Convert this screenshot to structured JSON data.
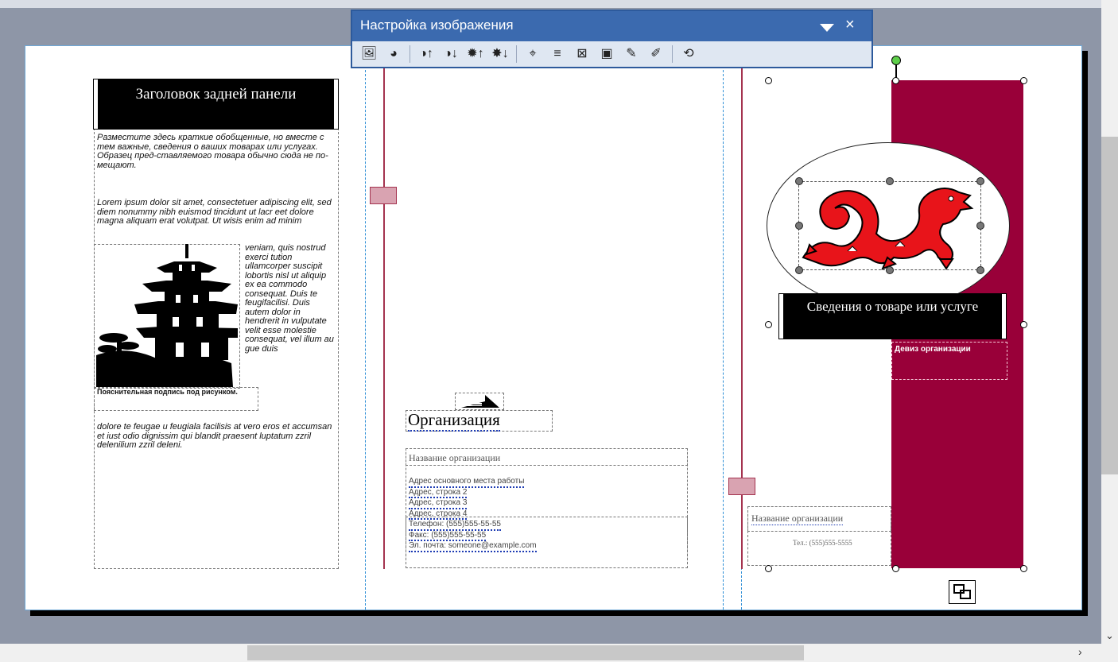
{
  "toolbar": {
    "title": "Настройка изображения",
    "close_glyph": "×",
    "buttons": [
      {
        "name": "insert-picture",
        "glyph": "🖼"
      },
      {
        "name": "color",
        "glyph": "◕"
      },
      {
        "name": "more-contrast",
        "glyph": "◑↑"
      },
      {
        "name": "less-contrast",
        "glyph": "◑↓"
      },
      {
        "name": "more-brightness",
        "glyph": "✹↑"
      },
      {
        "name": "less-brightness",
        "glyph": "✸↓"
      },
      {
        "name": "crop",
        "glyph": "⌖"
      },
      {
        "name": "line-style",
        "glyph": "≡"
      },
      {
        "name": "compress",
        "glyph": "⊠"
      },
      {
        "name": "text-wrapping",
        "glyph": "▣"
      },
      {
        "name": "format-picture",
        "glyph": "✎"
      },
      {
        "name": "set-transparent",
        "glyph": "✐"
      },
      {
        "name": "reset-picture",
        "glyph": "⟲"
      }
    ]
  },
  "back_panel": {
    "heading": "Заголовок задней панели",
    "intro": "Разместите здесь краткие обобщенные, но вместе с тем важные, сведения о ваших товарах или услугах. Образец пред-ставляемого товара обычно сюда не по-мещают.",
    "lorem_top": "Lorem ipsum dolor sit amet, consectetuer adipiscing elit, sed diem nonummy nibh euismod tincidunt ut lacr eet dolore magna aliquam erat volutpat. Ut wisis enim ad minim",
    "lorem_wrap": "veniam, quis nostrud exerci tution ullamcorper suscipit lobortis nisl ut aliquip ex ea commodo consequat. Duis te feugifacilisi. Duis autem dolor in hendrerit in vulputate velit esse molestie consequat, vel illum au gue duis",
    "lorem_bottom": "dolore te feugae u feugiala facilisis at vero eros et accumsan et iust odio dignissim qui blandit praesent luptatum zzril delenilium zzril deleni.",
    "caption": "Пояснительная подпись под рисунком."
  },
  "middle_panel": {
    "org_label": "Организация",
    "org_name": "Название организации",
    "address_lines": [
      "Адрес основного места работы",
      "Адрес, строка 2",
      "Адрес, строка 3",
      "Адрес, строка 4"
    ],
    "contact_lines": [
      "Телефон: (555)555-55-55",
      "Факс: (555)555-55-55",
      "Эл. почта: someone@example.com"
    ]
  },
  "front_panel": {
    "product_heading": "Сведения о товаре или услуге",
    "motto": "Девиз организации",
    "org_name": "Название организации",
    "phone": "Тел.: (555)555-5555"
  },
  "colors": {
    "accent_maroon": "#990039",
    "toolbar_blue": "#3b6aaf",
    "guide_blue": "#2f8fd6"
  }
}
